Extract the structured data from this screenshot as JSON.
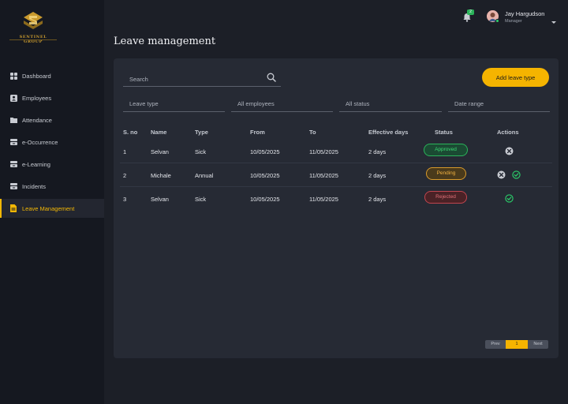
{
  "brand": {
    "name": "SENTINEL GROUP"
  },
  "sidebar": {
    "items": [
      {
        "label": "Dashboard",
        "icon": "dashboard-icon"
      },
      {
        "label": "Employees",
        "icon": "employee-icon"
      },
      {
        "label": "Attendance",
        "icon": "folder-icon"
      },
      {
        "label": "e-Occurrence",
        "icon": "stack-icon"
      },
      {
        "label": "e-Learning",
        "icon": "stack-icon"
      },
      {
        "label": "Incidents",
        "icon": "stack-icon"
      },
      {
        "label": "Leave Management",
        "icon": "document-icon",
        "active": true
      }
    ]
  },
  "header": {
    "notifications_count": "2",
    "user_name": "Jay Hargudson",
    "user_role": "Manager"
  },
  "page": {
    "title": "Leave management"
  },
  "toolbar": {
    "search_placeholder": "Search",
    "add_label": "Add leave type"
  },
  "filters": {
    "leave_type": "Leave type",
    "employees": "All employees",
    "status": "All status",
    "date_range": "Date range"
  },
  "table": {
    "columns": [
      "S. no",
      "Name",
      "Type",
      "From",
      "To",
      "Effective days",
      "Status",
      "Actions"
    ],
    "rows": [
      {
        "sno": "1",
        "name": "Selvan",
        "type": "Sick",
        "from": "10/05/2025",
        "to": "11/05/2025",
        "days": "2 days",
        "status": "Approved",
        "actions": [
          "reject"
        ]
      },
      {
        "sno": "2",
        "name": "Michale",
        "type": "Annual",
        "from": "10/05/2025",
        "to": "11/05/2025",
        "days": "2 days",
        "status": "Pending",
        "actions": [
          "reject",
          "approve"
        ]
      },
      {
        "sno": "3",
        "name": "Selvan",
        "type": "Sick",
        "from": "10/05/2025",
        "to": "11/05/2025",
        "days": "2 days",
        "status": "Rejected",
        "actions": [
          "approve"
        ]
      }
    ]
  },
  "pagination": {
    "prev": "Prev",
    "current": "1",
    "next": "Next"
  },
  "colors": {
    "accent": "#f5b400",
    "approved": "#3bd873",
    "pending": "#f0b040",
    "rejected": "#e07078"
  }
}
